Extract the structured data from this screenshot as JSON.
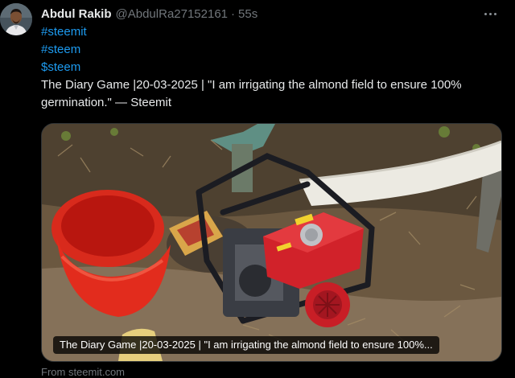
{
  "author": {
    "name": "Abdul Rakib",
    "handle": "@AbdulRa27152161",
    "separator": "·",
    "time": "55s"
  },
  "tweet": {
    "hashtags": [
      "#steemit",
      "#steem"
    ],
    "cashtag": "$steem",
    "text": "The Diary Game |20-03-2025 | \"I am irrigating the almond field to ensure 100% germination.\" — Steemit"
  },
  "card": {
    "title": "The Diary Game |20-03-2025 | \"I am irrigating the almond field to ensure 100%...",
    "source": "From steemit.com"
  },
  "icons": {
    "more": "more-options-icon"
  },
  "colors": {
    "background": "#000000",
    "text": "#e7e9ea",
    "secondary": "#71767b",
    "link": "#1d9bf0"
  }
}
